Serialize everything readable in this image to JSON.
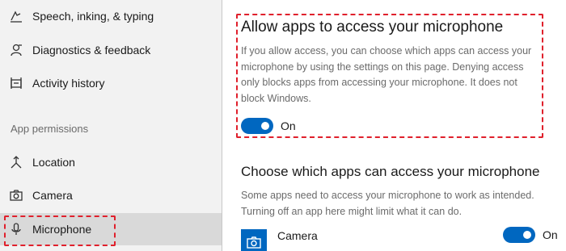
{
  "sidebar": {
    "items": [
      {
        "label": "Speech, inking, & typing",
        "icon": "speech-icon"
      },
      {
        "label": "Diagnostics & feedback",
        "icon": "diagnostics-icon"
      },
      {
        "label": "Activity history",
        "icon": "activity-history-icon"
      }
    ],
    "section_header": "App permissions",
    "permissions": [
      {
        "label": "Location",
        "icon": "location-icon"
      },
      {
        "label": "Camera",
        "icon": "camera-icon"
      },
      {
        "label": "Microphone",
        "icon": "microphone-icon",
        "selected": true
      }
    ]
  },
  "main": {
    "allow_card": {
      "title": "Allow apps to access your microphone",
      "description": "If you allow access, you can choose which apps can access your microphone by using the settings on this page. Denying access only blocks apps from accessing your microphone. It does not block Windows.",
      "toggle_state": "On",
      "toggle_on": true
    },
    "choose_section": {
      "title": "Choose which apps can access your microphone",
      "description": "Some apps need to access your microphone to work as intended. Turning off an app here might limit what it can do."
    },
    "apps": [
      {
        "name": "Camera",
        "icon": "camera-app-icon",
        "toggle_state": "On",
        "toggle_on": true
      }
    ]
  },
  "colors": {
    "accent": "#0067c0",
    "highlight": "#e0202c",
    "sidebar_bg": "#f2f2f2",
    "secondary_text": "#6b6b6b"
  }
}
